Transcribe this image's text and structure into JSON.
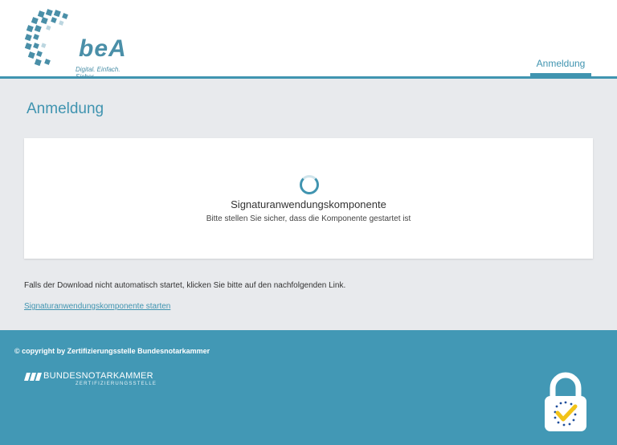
{
  "header": {
    "logo_text": "beA",
    "logo_tagline": "Digital. Einfach. Sicher.",
    "nav_tab": "Anmeldung"
  },
  "main": {
    "page_title": "Anmeldung",
    "card": {
      "title": "Signaturanwendungskomponente",
      "subtitle": "Bitte stellen Sie sicher, dass die Komponente gestartet ist"
    },
    "info_text": "Falls der Download nicht automatisch startet, klicken Sie bitte auf den nachfolgenden Link.",
    "link_text": "Signaturanwendungskomponente starten"
  },
  "footer": {
    "copyright": "© copyright by Zertifizierungsstelle Bundesnotarkammer",
    "org_name": "BUNDESNOTARKAMMER",
    "org_sub": "ZERTIFIZIERUNGSSTELLE"
  },
  "colors": {
    "accent": "#4094b0",
    "footer_bg": "#4298b5",
    "page_bg": "#e8eaed",
    "check_yellow": "#f2c318"
  },
  "icons": [
    "bea-logo-icon",
    "loading-spinner-icon",
    "bundesnotarkammer-logo-icon",
    "security-lock-icon"
  ]
}
